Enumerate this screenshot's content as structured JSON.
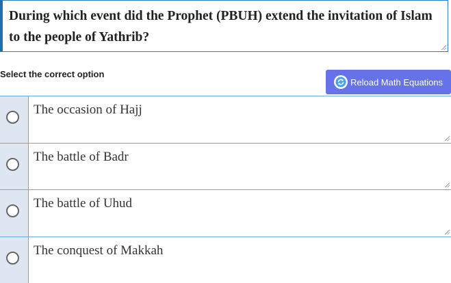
{
  "question": {
    "text": "During which event did the Prophet (PBUH) extend the invitation of Islam to the people of Yathrib?"
  },
  "instructions": {
    "select_label": "Select the correct option"
  },
  "toolbar": {
    "reload_label": "Reload Math Equations",
    "reload_icon": "refresh-icon"
  },
  "colors": {
    "accent": "#6672e8",
    "border": "#6aa7d6",
    "radio_bg": "#dde6f1",
    "question_border": "#1e6fb0"
  },
  "options": [
    {
      "label": "The occasion of Hajj"
    },
    {
      "label": "The battle of Badr"
    },
    {
      "label": "The battle of Uhud"
    },
    {
      "label": "The conquest of Makkah"
    }
  ]
}
